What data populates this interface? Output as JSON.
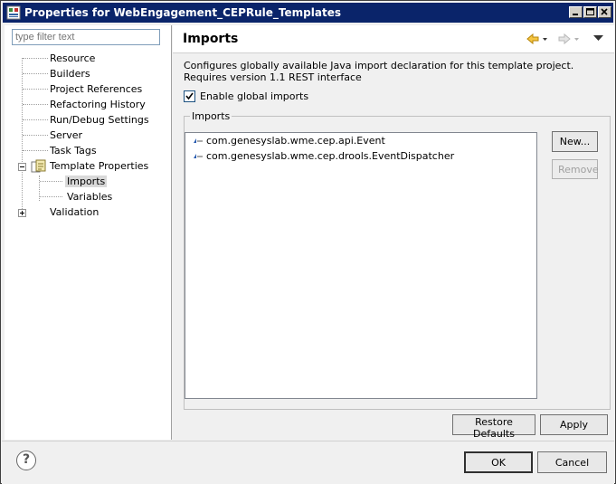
{
  "window": {
    "title": "Properties for WebEngagement_CEPRule_Templates"
  },
  "filter": {
    "placeholder": "type filter text"
  },
  "tree": {
    "items": [
      {
        "label": "Resource"
      },
      {
        "label": "Builders"
      },
      {
        "label": "Project References"
      },
      {
        "label": "Refactoring History"
      },
      {
        "label": "Run/Debug Settings"
      },
      {
        "label": "Server"
      },
      {
        "label": "Task Tags"
      },
      {
        "label": "Template Properties"
      },
      {
        "label": "Imports"
      },
      {
        "label": "Variables"
      },
      {
        "label": "Validation"
      }
    ],
    "selected": "Imports"
  },
  "page": {
    "title": "Imports",
    "description": "Configures globally available Java import declaration for this template project.  Requires version 1.1 REST interface",
    "enable_label": "Enable global imports",
    "enable_checked": true,
    "group_label": "Imports",
    "imports": [
      "com.genesyslab.wme.cep.api.Event",
      "com.genesyslab.wme.cep.drools.EventDispatcher"
    ],
    "new_button": "New...",
    "remove_button": "Remove",
    "restore_button": "Restore Defaults",
    "apply_button": "Apply"
  },
  "dialog": {
    "ok_button": "OK",
    "cancel_button": "Cancel"
  },
  "colors": {
    "titlebar": "#0a246a",
    "accent": "#e8a317"
  }
}
